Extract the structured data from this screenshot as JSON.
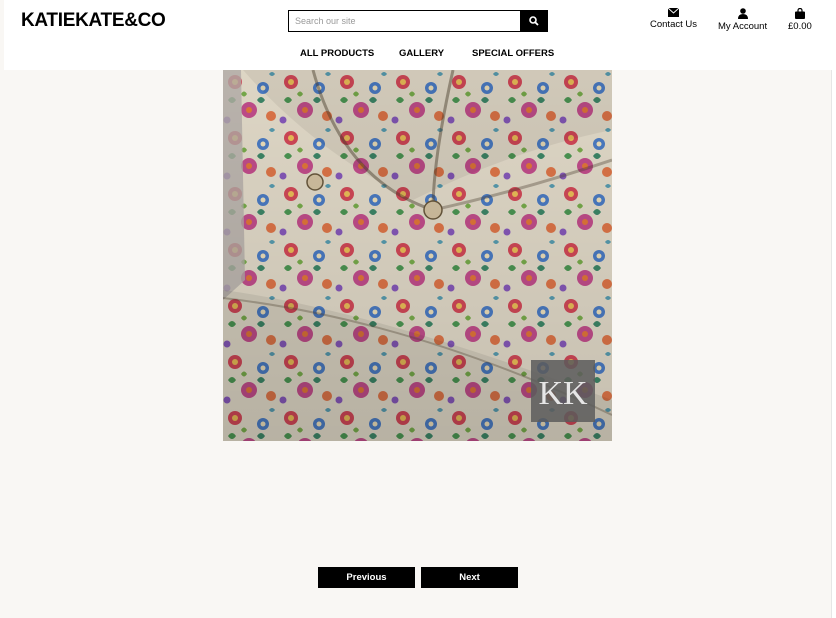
{
  "brand": {
    "name": "KATIEKATE&CO"
  },
  "search": {
    "placeholder": "Search our site",
    "button_icon": "search-icon"
  },
  "utility": {
    "contact_label": "Contact Us",
    "account_label": "My Account",
    "basket_total": "£0.00"
  },
  "nav": {
    "items": [
      "ALL PRODUCTS",
      "GALLERY",
      "SPECIAL OFFERS"
    ]
  },
  "gallery": {
    "watermark": "KK"
  },
  "pager": {
    "previous_label": "Previous",
    "next_label": "Next"
  },
  "colors": {
    "header_bg": "#ffffff",
    "page_bg": "#f9f7f4",
    "button_bg": "#000000"
  }
}
